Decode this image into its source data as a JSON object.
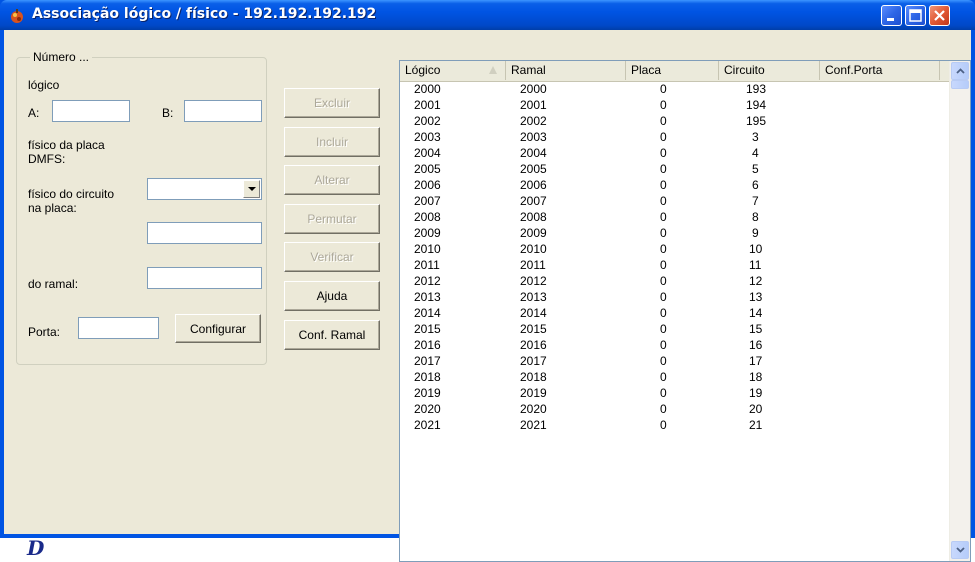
{
  "window": {
    "title": "Associação lógico / físico - 192.192.192.192"
  },
  "group": {
    "legend": "Número ...",
    "logico_label": "lógico",
    "a_label": "A:",
    "b_label": "B:",
    "a_value": "",
    "b_value": "",
    "placa_label_line1": "físico da placa",
    "placa_label_line2": "DMFS:",
    "placa_value": "",
    "circuito_label_line1": "físico do circuito",
    "circuito_label_line2": "na placa:",
    "circuito_value": "",
    "ramal_label": "do ramal:",
    "ramal_value": "",
    "porta_label": "Porta:",
    "porta_value": "",
    "configurar_label": "Configurar"
  },
  "actions": {
    "excluir": "Excluir",
    "incluir": "Incluir",
    "alterar": "Alterar",
    "permutar": "Permutar",
    "verificar": "Verificar",
    "ajuda": "Ajuda",
    "conf_ramal": "Conf. Ramal"
  },
  "table": {
    "columns": [
      "Lógico",
      "Ramal",
      "Placa",
      "Circuito",
      "Conf.Porta"
    ],
    "rows": [
      [
        "2000",
        "2000",
        "0",
        "193",
        ""
      ],
      [
        "2001",
        "2001",
        "0",
        "194",
        ""
      ],
      [
        "2002",
        "2002",
        "0",
        "195",
        ""
      ],
      [
        "2003",
        "2003",
        "0",
        "3",
        ""
      ],
      [
        "2004",
        "2004",
        "0",
        "4",
        ""
      ],
      [
        "2005",
        "2005",
        "0",
        "5",
        ""
      ],
      [
        "2006",
        "2006",
        "0",
        "6",
        ""
      ],
      [
        "2007",
        "2007",
        "0",
        "7",
        ""
      ],
      [
        "2008",
        "2008",
        "0",
        "8",
        ""
      ],
      [
        "2009",
        "2009",
        "0",
        "9",
        ""
      ],
      [
        "2010",
        "2010",
        "0",
        "10",
        ""
      ],
      [
        "2011",
        "2011",
        "0",
        "11",
        ""
      ],
      [
        "2012",
        "2012",
        "0",
        "12",
        ""
      ],
      [
        "2013",
        "2013",
        "0",
        "13",
        ""
      ],
      [
        "2014",
        "2014",
        "0",
        "14",
        ""
      ],
      [
        "2015",
        "2015",
        "0",
        "15",
        ""
      ],
      [
        "2016",
        "2016",
        "0",
        "16",
        ""
      ],
      [
        "2017",
        "2017",
        "0",
        "17",
        ""
      ],
      [
        "2018",
        "2018",
        "0",
        "18",
        ""
      ],
      [
        "2019",
        "2019",
        "0",
        "19",
        ""
      ],
      [
        "2020",
        "2020",
        "0",
        "20",
        ""
      ],
      [
        "2021",
        "2021",
        "0",
        "21",
        ""
      ]
    ]
  },
  "logo": {
    "text": "D"
  },
  "icons": {
    "app": "app-icon",
    "minimize": "minimize-icon",
    "maximize": "maximize-icon",
    "close": "close-icon",
    "sort": "sort-asc-icon",
    "scroll_up": "chevron-up-icon",
    "scroll_down": "chevron-down-icon",
    "combo": "chevron-down-icon"
  },
  "colors": {
    "titlebar": "#0054e3",
    "dialog_bg": "#ece9d8",
    "close_button": "#e25a35",
    "disabled_text": "#aca899"
  }
}
